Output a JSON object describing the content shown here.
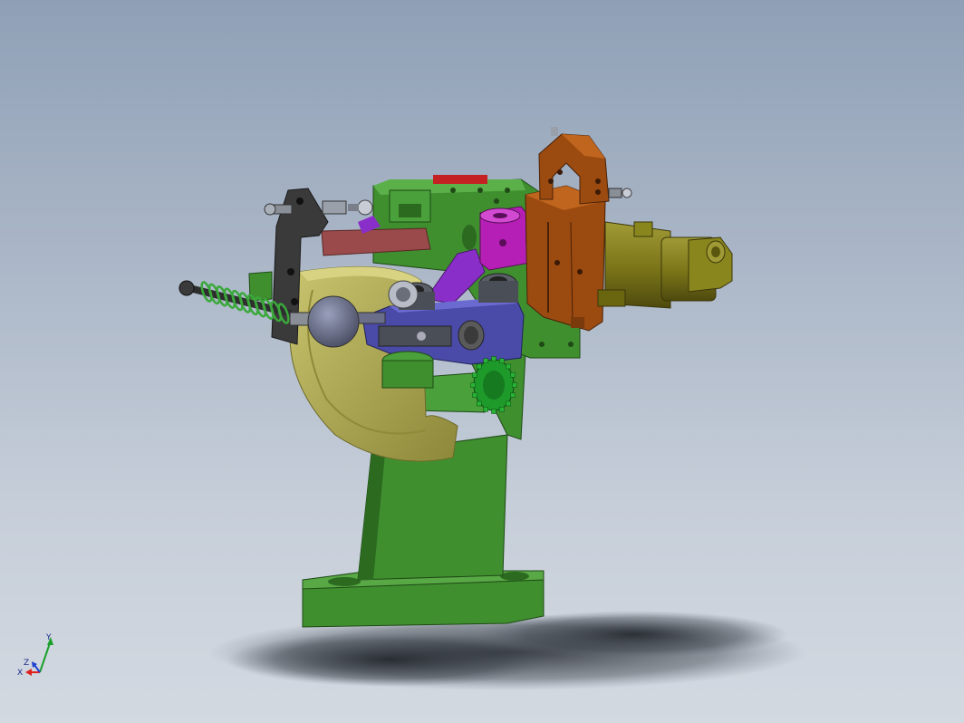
{
  "viewport": {
    "background_top": "#8fa0b6",
    "background_bottom": "#d3d9e1"
  },
  "triad": {
    "x_label": "X",
    "y_label": "Y",
    "z_label": "Z",
    "x_color": "#e0201a",
    "y_color": "#1aa02a",
    "z_color": "#2040d0"
  },
  "part_colors": {
    "base": "#3f8f2f",
    "base_dark": "#2c6a20",
    "ring": "#b5b055",
    "ring_dark": "#8f8a3a",
    "bracket": "#3a3a3a",
    "spring": "#3aa83a",
    "lever": "#4a4aa8",
    "knob": "#6a6e88",
    "magenta": "#b61fb6",
    "violet": "#8a2ec9",
    "copper": "#9b4a10",
    "copper_light": "#c0651e",
    "cylinder": "#7e7a1c",
    "red_block": "#9a4a4a",
    "gear": "#1e9a2a"
  }
}
